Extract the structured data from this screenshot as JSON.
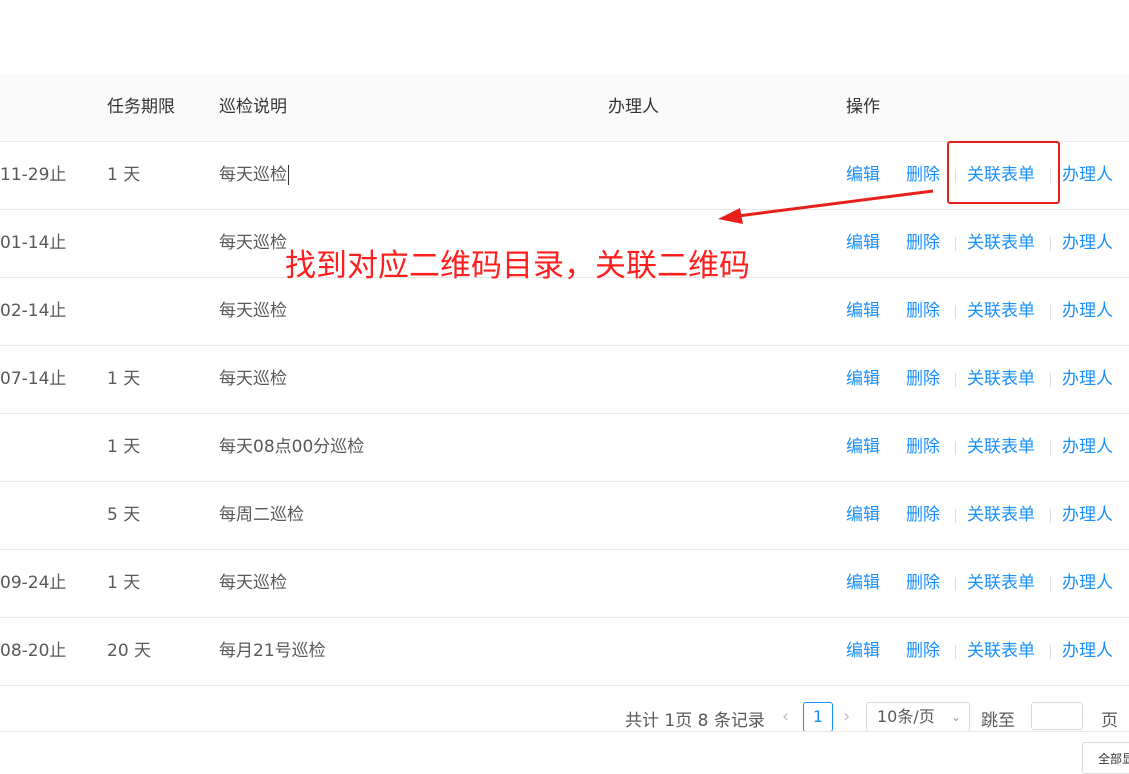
{
  "table": {
    "headers": {
      "period": "任务期限",
      "desc": "巡检说明",
      "handler": "办理人",
      "ops": "操作"
    },
    "actions": {
      "edit": "编辑",
      "delete": "删除",
      "link_form": "关联表单",
      "handler": "办理人"
    },
    "rows": [
      {
        "date": "11-29止",
        "period": "1 天",
        "desc": "每天巡检"
      },
      {
        "date": "01-14止",
        "period": "",
        "desc": "每天巡检"
      },
      {
        "date": "02-14止",
        "period": "",
        "desc": "每天巡检"
      },
      {
        "date": "07-14止",
        "period": "1 天",
        "desc": "每天巡检"
      },
      {
        "date": "",
        "period": "1 天",
        "desc": "每天08点00分巡检"
      },
      {
        "date": "",
        "period": "5 天",
        "desc": "每周二巡检"
      },
      {
        "date": "09-24止",
        "period": "1 天",
        "desc": "每天巡检"
      },
      {
        "date": "08-20止",
        "period": "20 天",
        "desc": "每月21号巡检"
      }
    ]
  },
  "pagination": {
    "total": "共计 1页 8 条记录",
    "current_page": "1",
    "page_size": "10条/页",
    "jump_label": "跳至",
    "jump_value": "",
    "page_suffix": "页"
  },
  "show_all": "全部显示",
  "annotation": {
    "text": "找到对应二维码目录，关联二维码",
    "color": "#ff1f1f"
  },
  "colors": {
    "link": "#1890ff",
    "highlight": "#e8201c"
  },
  "icons": {
    "prev": "chevron-left-icon",
    "next": "chevron-right-icon",
    "dropdown": "chevron-down-icon"
  }
}
